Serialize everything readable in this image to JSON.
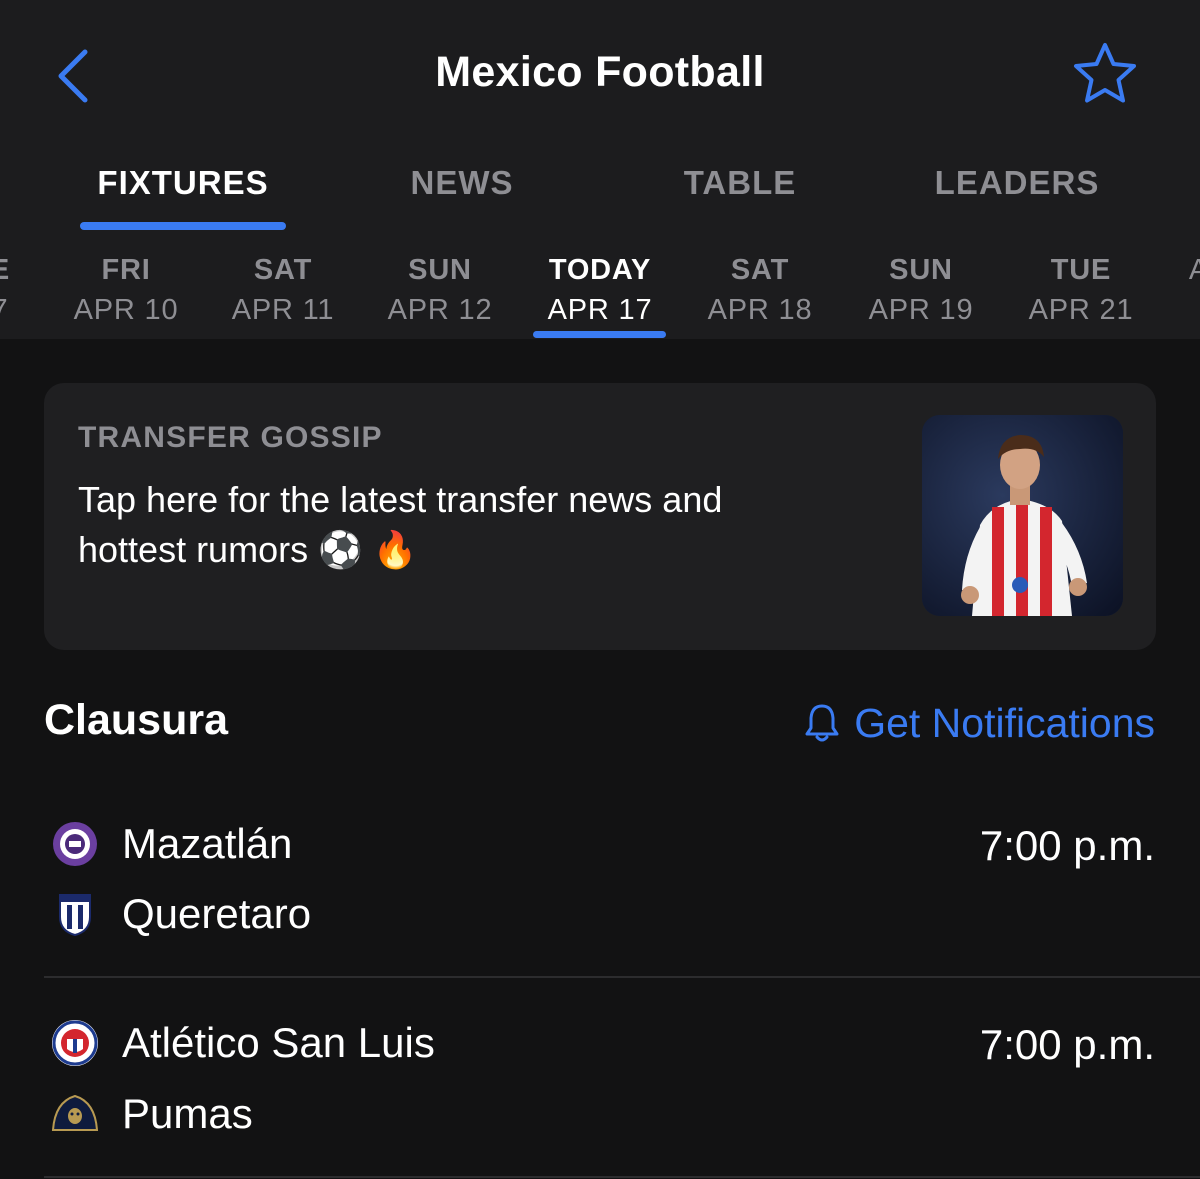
{
  "header": {
    "title": "Mexico Football",
    "back_icon": "chevron-left-icon",
    "favorite_icon": "star-icon"
  },
  "tabs": [
    {
      "label": "FIXTURES",
      "active": true
    },
    {
      "label": "NEWS",
      "active": false
    },
    {
      "label": "TABLE",
      "active": false
    },
    {
      "label": "LEADERS",
      "active": false
    }
  ],
  "dates": [
    {
      "dow": "E",
      "day": "7",
      "active": false
    },
    {
      "dow": "FRI",
      "day": "APR 10",
      "active": false
    },
    {
      "dow": "SAT",
      "day": "APR 11",
      "active": false
    },
    {
      "dow": "SUN",
      "day": "APR 12",
      "active": false
    },
    {
      "dow": "TODAY",
      "day": "APR 17",
      "active": true
    },
    {
      "dow": "SAT",
      "day": "APR 18",
      "active": false
    },
    {
      "dow": "SUN",
      "day": "APR 19",
      "active": false
    },
    {
      "dow": "TUE",
      "day": "APR 21",
      "active": false
    },
    {
      "dow": "",
      "day": "A",
      "active": false
    }
  ],
  "gossip": {
    "label": "TRANSFER GOSSIP",
    "text": "Tap here for the latest transfer news and hottest rumors ⚽ 🔥"
  },
  "section": {
    "title": "Clausura",
    "notif_label": "Get Notifications",
    "notif_icon": "bell-icon"
  },
  "matches": [
    {
      "home": "Mazatlán",
      "away": "Queretaro",
      "time": "7:00 p.m."
    },
    {
      "home": "Atlético San Luis",
      "away": "Pumas",
      "time": "7:00 p.m."
    }
  ],
  "colors": {
    "accent": "#3a7bf2",
    "background": "#121213",
    "header_bg": "#1c1c1e",
    "muted": "#8e8e93"
  }
}
